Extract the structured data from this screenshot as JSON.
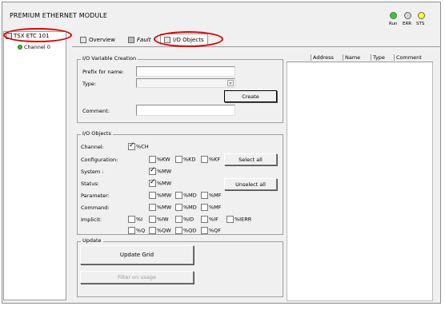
{
  "window": {
    "title": "PREMIUM ETHERNET MODULE"
  },
  "leds": [
    {
      "label": "Run",
      "color": "#33cc33"
    },
    {
      "label": "ERR",
      "color": "#d8d8d8"
    },
    {
      "label": "STS",
      "color": "#ffff33"
    }
  ],
  "tree": {
    "root": "TSX ETC 101",
    "child": "Channel 0"
  },
  "tabs": {
    "overview": "Overview",
    "fault": "Fault",
    "io_objects": "I/O Objects"
  },
  "var_creation": {
    "legend": "I/O Variable Creation",
    "prefix_label": "Prefix for name:",
    "prefix_value": "",
    "type_label": "Type:",
    "type_value": "",
    "create": "Create",
    "comment_label": "Comment:",
    "comment_value": ""
  },
  "io_objects": {
    "legend": "I/O Objects",
    "channel_label": "Channel:",
    "channel_ch": "%CH",
    "configuration_label": "Configuration:",
    "kw": "%KW",
    "kd": "%KD",
    "kf": "%KF",
    "select_all": "Select all",
    "system_label": "System :",
    "system_mw": "%MW",
    "status_label": "Status:",
    "status_mw": "%MW",
    "unselect_all": "Unselect all",
    "parameter_label": "Parameter:",
    "param_mw": "%MW",
    "param_md": "%MD",
    "param_mf": "%MF",
    "command_label": "Command:",
    "cmd_mw": "%MW",
    "cmd_md": "%MD",
    "cmd_mf": "%MF",
    "implicit_label": "Implicit:",
    "imp_i": "%I",
    "imp_iw": "%IW",
    "imp_id": "%ID",
    "imp_if": "%IF",
    "imp_ierr": "%IERR",
    "imp_q": "%Q",
    "imp_qw": "%QW",
    "imp_qd": "%QD",
    "imp_qf": "%QF"
  },
  "update": {
    "legend": "Update",
    "update_grid": "Update Grid",
    "filter": "Filter on usage"
  },
  "grid": {
    "columns": [
      "Address",
      "Name",
      "Type",
      "Comment"
    ]
  }
}
